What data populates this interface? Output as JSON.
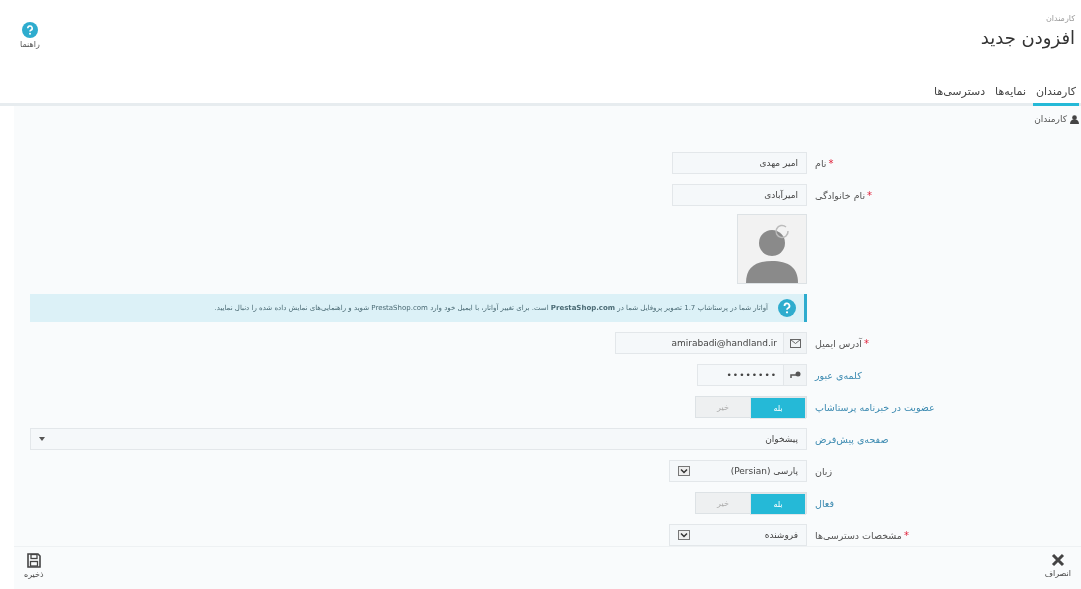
{
  "header": {
    "breadcrumb": "کارمندان",
    "title": "افزودن جدید",
    "help_button": "راهنما"
  },
  "tabs": [
    {
      "label": "کارمندان",
      "selected": true
    },
    {
      "label": "نمایه‌ها",
      "selected": false
    },
    {
      "label": "دسترسی‌ها",
      "selected": false
    }
  ],
  "panel": {
    "title": "کارمندان"
  },
  "fields": [
    {
      "kind": "text",
      "label": "نام",
      "required_mark": "*",
      "has_hint": false,
      "value": "امیر مهدی"
    },
    {
      "kind": "text",
      "label": "نام خانوادگی",
      "required_mark": "*",
      "has_hint": false,
      "value": "امیرآبادی"
    },
    {
      "kind": "avatar"
    },
    {
      "kind": "info",
      "text": "آواتار شما در پرستاشاپ 1.7 تصویر پروفایل شما در **PrestaShop.com** است. برای تغییر آواتار، با ایمیل خود وارد PrestaShop.com شوید و راهنمایی‌های نمایش داده شده را دنبال نمایید."
    },
    {
      "kind": "email",
      "label": "آدرس ایمیل",
      "required_mark": "*",
      "has_hint": false,
      "value": "amirabadi@handland.ir"
    },
    {
      "kind": "password",
      "label": "کلمه‌ی عبور",
      "has_hint": true,
      "value": "••••••••"
    },
    {
      "kind": "switch",
      "label": "عضویت در خبرنامه پرستاشاپ",
      "has_hint": true,
      "options": [
        {
          "label": "بله",
          "selected": true
        },
        {
          "label": "خیر",
          "selected": false
        }
      ]
    },
    {
      "kind": "wide-select",
      "label": "صفحه‌ی پیش‌فرض",
      "has_hint": true,
      "value": "پیشخوان"
    },
    {
      "kind": "select",
      "label": "زبان",
      "has_hint": false,
      "value": "پارسی (Persian)"
    },
    {
      "kind": "switch",
      "label": "فعال",
      "has_hint": true,
      "options": [
        {
          "label": "بله",
          "selected": true
        },
        {
          "label": "خیر",
          "selected": false
        }
      ]
    },
    {
      "kind": "select",
      "label": "مشخصات دسترسی‌ها",
      "required_mark": "*",
      "has_hint": false,
      "value": "فروشنده"
    }
  ],
  "footer": {
    "cancel_button": "انصراف",
    "save_button": "ذخیره"
  }
}
